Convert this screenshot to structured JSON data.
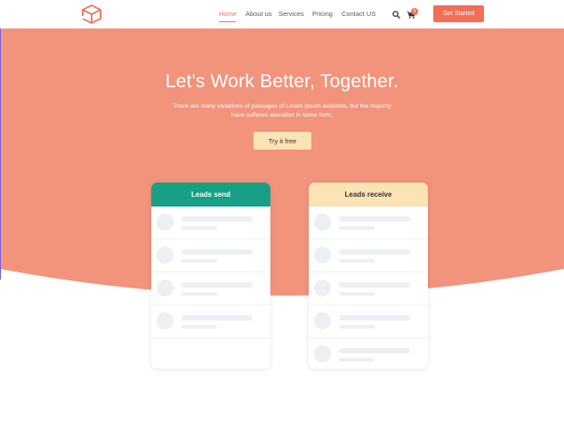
{
  "nav": {
    "items": [
      {
        "label": "Home",
        "active": true
      },
      {
        "label": "About us",
        "active": false
      },
      {
        "label": "Services",
        "active": false
      },
      {
        "label": "Pricing",
        "active": false
      },
      {
        "label": "Contact US",
        "active": false
      }
    ],
    "search_icon": "search-icon",
    "cart_icon": "cart-icon",
    "cart_count": "0",
    "cta_label": "Get Started"
  },
  "hero": {
    "title": "Let's Work Better, Together.",
    "subtitle": "There are many variations of passages of Lorem Ipsum available, but the majority have suffered alteration in some form,",
    "button_label": "Try it free"
  },
  "cards": {
    "left": {
      "title": "Leads send",
      "rows": 4
    },
    "right": {
      "title": "Leads receive",
      "rows": 5
    }
  },
  "colors": {
    "accent": "#f26e57",
    "hero_bg": "#f2937c",
    "green": "#17a085",
    "cream": "#fbe3b6"
  }
}
